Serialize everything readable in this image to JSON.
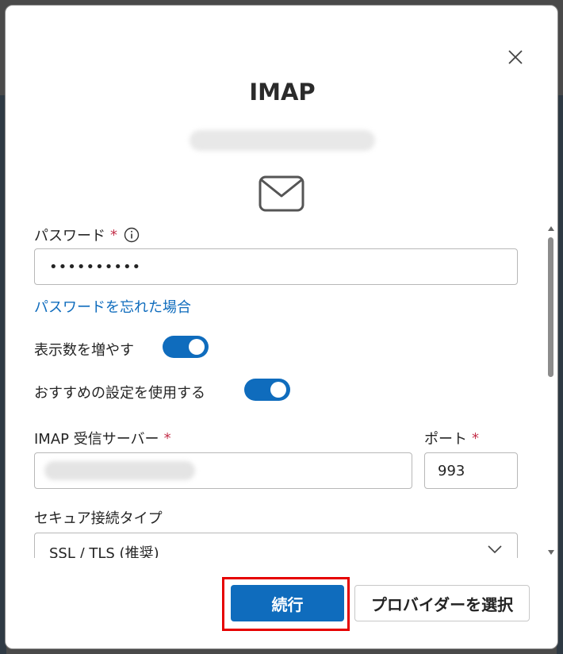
{
  "dialog": {
    "title": "IMAP",
    "close_icon": "close-icon",
    "mail_icon": "mail-icon"
  },
  "password": {
    "label": "パスワード",
    "required_mark": "*",
    "info_icon": "info-icon",
    "value": "••••••••••",
    "forgot_link": "パスワードを忘れた場合"
  },
  "toggles": [
    {
      "label": "表示数を増やす",
      "on": true
    },
    {
      "label": "おすすめの設定を使用する",
      "on": true
    }
  ],
  "imap_server": {
    "label": "IMAP 受信サーバー",
    "required_mark": "*"
  },
  "port": {
    "label": "ポート",
    "required_mark": "*",
    "value": "993"
  },
  "security": {
    "label": "セキュア接続タイプ",
    "selected": "SSL / TLS (推奨)"
  },
  "actions": {
    "continue_label": "続行",
    "choose_provider_label": "プロバイダーを選択"
  },
  "colors": {
    "accent": "#0f6cbd",
    "required": "#c4314b",
    "highlight": "#e60000"
  }
}
